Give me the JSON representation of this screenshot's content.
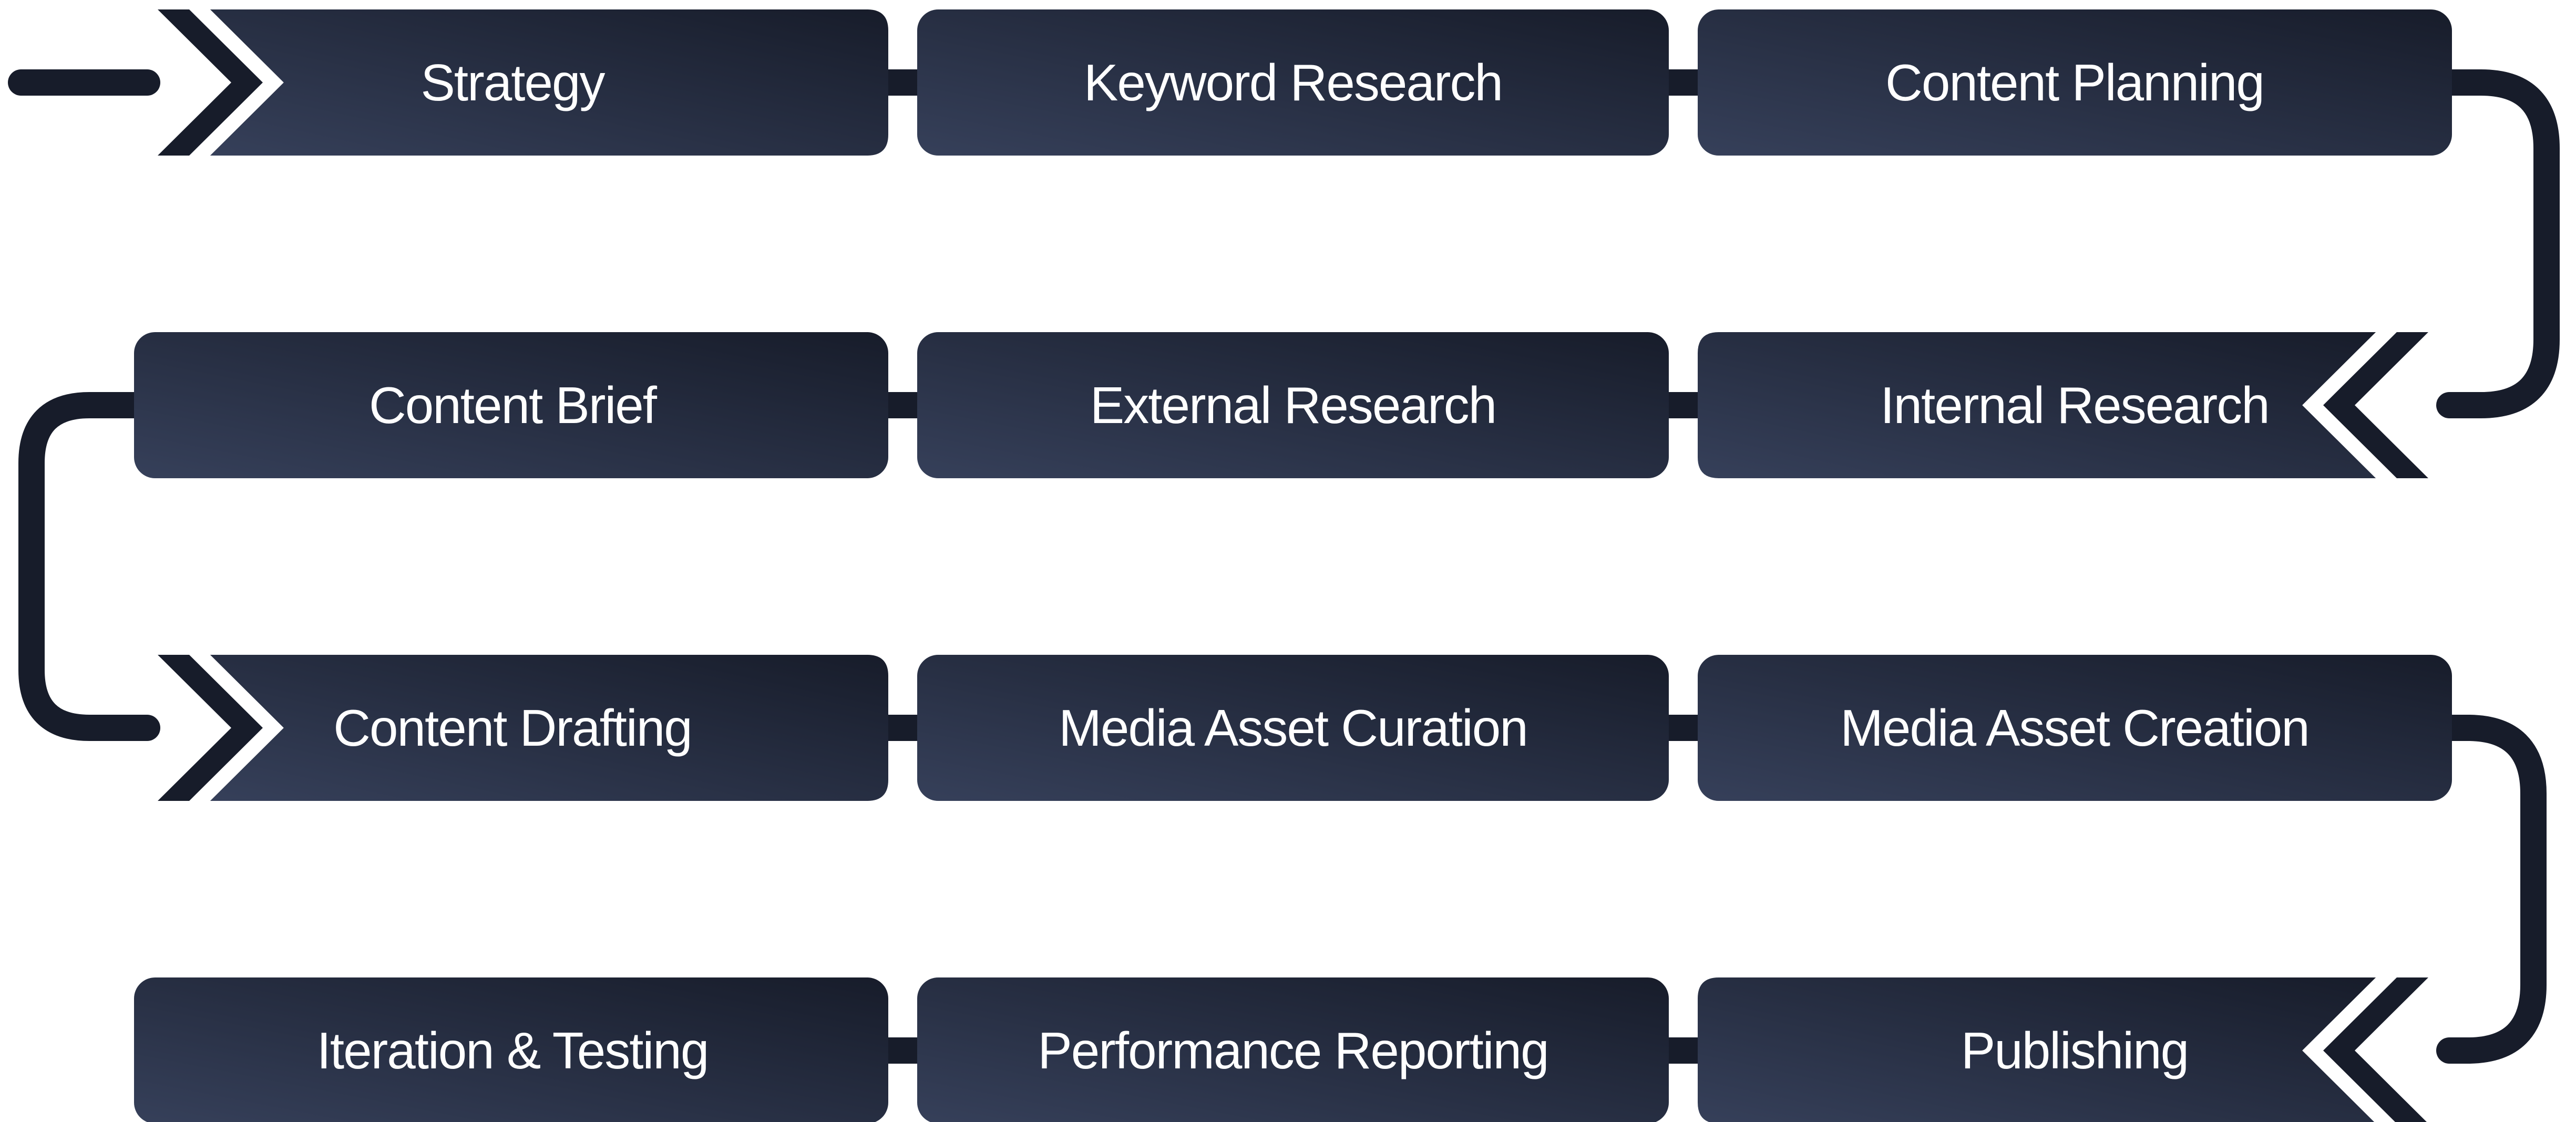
{
  "colors": {
    "box_dark": "#171c2a",
    "box_light": "#36405a",
    "connector": "#171c2a",
    "text": "#ffffff",
    "background": "#ffffff"
  },
  "steps": [
    {
      "label": "Strategy"
    },
    {
      "label": "Keyword Research"
    },
    {
      "label": "Content Planning"
    },
    {
      "label": "Internal Research"
    },
    {
      "label": "External Research"
    },
    {
      "label": "Content Brief"
    },
    {
      "label": "Content Drafting"
    },
    {
      "label": "Media Asset Curation"
    },
    {
      "label": "Media Asset Creation"
    },
    {
      "label": "Publishing"
    },
    {
      "label": "Performance Reporting"
    },
    {
      "label": "Iteration & Testing"
    }
  ]
}
